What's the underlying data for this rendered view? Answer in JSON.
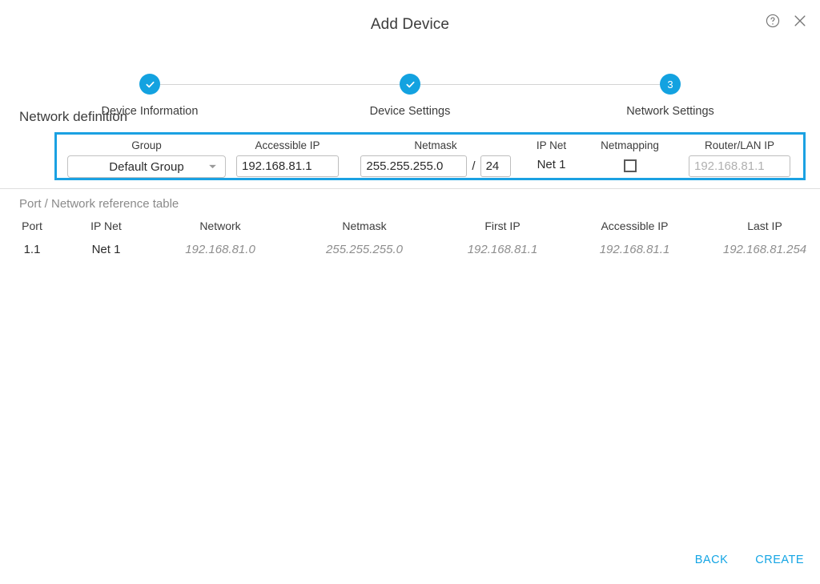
{
  "header": {
    "title": "Add Device",
    "help_icon": "help-circle-icon",
    "close_icon": "close-icon"
  },
  "stepper": {
    "steps": [
      {
        "label": "Device Information",
        "marker": "check",
        "state": "completed"
      },
      {
        "label": "Device Settings",
        "marker": "check",
        "state": "completed"
      },
      {
        "label": "Network Settings",
        "marker": "3",
        "state": "active"
      }
    ],
    "accent_color": "#13a2e0"
  },
  "section": {
    "title": "Network definition",
    "panel_border_color": "#1ba1e2"
  },
  "form": {
    "group": {
      "label": "Group",
      "value": "Default Group",
      "caret_icon": "chevron-down-icon"
    },
    "accessible_ip": {
      "label": "Accessible IP",
      "value": "192.168.81.1"
    },
    "netmask": {
      "label": "Netmask",
      "value": "255.255.255.0",
      "separator": "/",
      "prefix_value": "24"
    },
    "ip_net": {
      "label": "IP Net",
      "value": "Net 1"
    },
    "netmapping": {
      "label": "Netmapping",
      "checked": false
    },
    "router_lan_ip": {
      "label": "Router/LAN IP",
      "value": "",
      "placeholder": "192.168.81.1"
    }
  },
  "reference_table": {
    "title": "Port / Network reference table",
    "columns": [
      "Port",
      "IP Net",
      "Network",
      "Netmask",
      "First IP",
      "Accessible IP",
      "Last IP"
    ],
    "rows": [
      {
        "port": "1.1",
        "ip_net": "Net 1",
        "network": "192.168.81.0",
        "netmask": "255.255.255.0",
        "first_ip": "192.168.81.1",
        "accessible_ip": "192.168.81.1",
        "last_ip": "192.168.81.254"
      }
    ]
  },
  "footer": {
    "back_label": "BACK",
    "create_label": "CREATE",
    "link_color": "#14a5e4"
  }
}
